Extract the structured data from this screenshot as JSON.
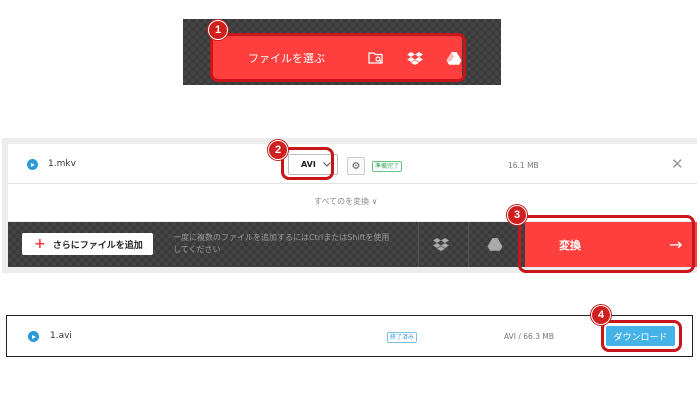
{
  "step1": {
    "badge": "1",
    "choose_file_label": "ファイルを選ぶ",
    "icons": [
      "folder-search-icon",
      "dropbox-icon",
      "google-drive-icon"
    ]
  },
  "step2": {
    "badge": "2",
    "file_name": "1.mkv",
    "format_value": "AVI",
    "status_tag": "準備完了",
    "file_size": "16.1 MB",
    "convert_all_label": "すべてのを変換 ∨"
  },
  "step3": {
    "badge": "3",
    "add_more_label": "さらにファイルを追加",
    "hint_text": "一度に複数のファイルを追加するにはCtrlまたはShiftを使用してください",
    "convert_label": "変換",
    "convert_arrow": "→"
  },
  "step4": {
    "badge": "4",
    "file_name": "1.avi",
    "status_tag": "終了済み",
    "file_info": "AVI / 66.3 MB",
    "download_label": "ダウンロード"
  },
  "colors": {
    "accent_red": "#ff3e3e",
    "highlight_red": "#c8151a",
    "download_blue": "#46b3e8",
    "ready_green": "#3aa85a"
  }
}
